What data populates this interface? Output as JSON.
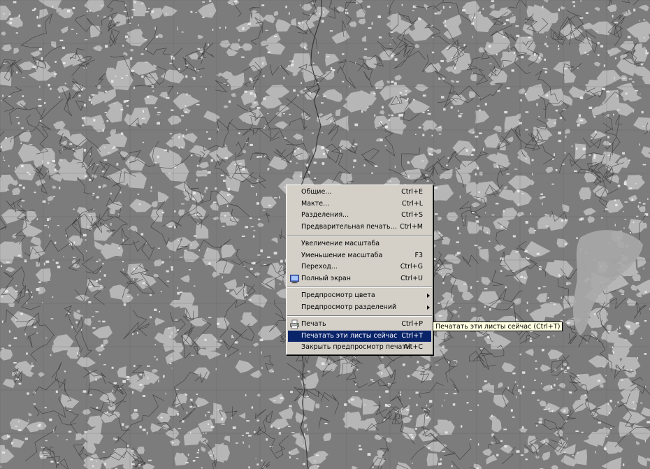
{
  "background": {
    "description_icon": "topographic-map"
  },
  "menu": {
    "groups": [
      [
        {
          "label": "Общие...",
          "shortcut": "Ctrl+E"
        },
        {
          "label": "Макте...",
          "shortcut": "Ctrl+L"
        },
        {
          "label": "Разделения...",
          "shortcut": "Ctrl+S"
        },
        {
          "label": "Предварительная печать...",
          "shortcut": "Ctrl+M"
        }
      ],
      [
        {
          "label": "Увеличение масштаба",
          "shortcut": ""
        },
        {
          "label": "Уменьшение масштаба",
          "shortcut": "F3"
        },
        {
          "label": "Переход...",
          "shortcut": "Ctrl+G"
        },
        {
          "label": "Полный экран",
          "shortcut": "Ctrl+U",
          "icon": "monitor-icon"
        }
      ],
      [
        {
          "label": "Предпросмотр цвета",
          "shortcut": "",
          "submenu": true
        },
        {
          "label": "Предпросмотр разделений",
          "shortcut": "",
          "submenu": true
        }
      ],
      [
        {
          "label": "Печать",
          "shortcut": "Ctrl+P",
          "icon": "printer-icon"
        },
        {
          "label": "Печатать эти листы сейчас",
          "shortcut": "Ctrl+T",
          "highlighted": true
        },
        {
          "label": "Закрыть предпросмотр печати",
          "shortcut": "Alt+C"
        }
      ]
    ]
  },
  "tooltip": {
    "text": "Печатать эти листы сейчас (Ctrl+T)"
  },
  "colors": {
    "menu_bg": "#d4d0c8",
    "highlight": "#0a246a",
    "tooltip_bg": "#ffffe1"
  }
}
